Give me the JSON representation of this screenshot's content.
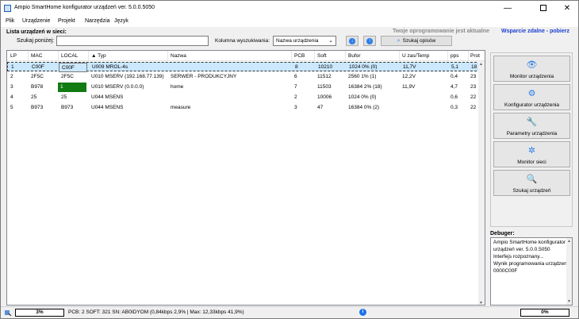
{
  "window": {
    "title": "Ampio SmartHome konfigurator urządzeń ver. 5.0.0.5050",
    "minimize": "—",
    "close": "✕"
  },
  "menu": [
    "Plik",
    "Urządzenie",
    "Projekt",
    "Narzędzia",
    "Język"
  ],
  "header": {
    "list_label": "Lista urządzeń w sieci:",
    "status": "Twoje oprogramowanie jest aktualne",
    "support_link": "Wsparcie zdalne - pobierz",
    "search_label": "Szukaj poniżej:",
    "search_value": "",
    "column_label": "Kolumna wyszukiwania:",
    "column_selected": "Nazwa urządzenia",
    "down_glyph": "↓",
    "up_glyph": "↑",
    "search_desc_label": "Szukaj opisów"
  },
  "table": {
    "columns": [
      "LP",
      "MAC",
      "LOCAL",
      "▲ Typ",
      "Nazwa",
      "PCB",
      "Soft",
      "Bufor",
      "U zas/Temp",
      "pps",
      "Prot"
    ],
    "rows": [
      {
        "lp": "1",
        "mac": "C00F",
        "local": "C00F",
        "typ": "U009 MROL-4s",
        "nazwa": "",
        "pcb": "8",
        "soft": "10210",
        "bufor": "1024 0% (0)",
        "u": "11,7V",
        "pps": "5,1",
        "prot": "18"
      },
      {
        "lp": "2",
        "mac": "2F5C",
        "local": "2F5C",
        "typ": "U010 MSERV (192.168.77.139)",
        "nazwa": "SERWER - PRODUKCYJNY",
        "pcb": "6",
        "soft": "11512",
        "bufor": "2560 1% (1)",
        "u": "12,2V",
        "pps": "0,4",
        "prot": "23"
      },
      {
        "lp": "3",
        "mac": "B978",
        "local": "1",
        "typ": "U010 MSERV (0.0.0.0)",
        "nazwa": "home",
        "pcb": "7",
        "soft": "11503",
        "bufor": "16384 2% (18)",
        "u": "11,9V",
        "pps": "4,7",
        "prot": "23"
      },
      {
        "lp": "4",
        "mac": "25",
        "local": "25",
        "typ": "U044 MSENS",
        "nazwa": "",
        "pcb": "2",
        "soft": "10006",
        "bufor": "1024 0% (0)",
        "u": "",
        "pps": "0,6",
        "prot": "22"
      },
      {
        "lp": "5",
        "mac": "B973",
        "local": "B973",
        "typ": "U044 MSENS",
        "nazwa": "measure",
        "pcb": "3",
        "soft": "47",
        "bufor": "16384 0% (2)",
        "u": "",
        "pps": "0,3",
        "prot": "22"
      }
    ],
    "scroll_up": "▲",
    "scroll_down": "▼"
  },
  "side_buttons": [
    {
      "label": "Monitor urządzenia",
      "icon": "eye-icon",
      "glyph": "👁"
    },
    {
      "label": "Konfigurator urządzenia",
      "icon": "gears-icon",
      "glyph": "⚙"
    },
    {
      "label": "Parametry urządzenia",
      "icon": "wrench-icon",
      "glyph": "🔧"
    },
    {
      "label": "Monitor sieci",
      "icon": "spinner-icon",
      "glyph": "✲"
    },
    {
      "label": "Szukaj urządzeń",
      "icon": "search-icon",
      "glyph": "🔍"
    }
  ],
  "debugger": {
    "label": "Debuger:",
    "lines": [
      "Ampio SmartHome konfigurator",
      "urządzeń ver. 5.0.0.5050",
      "Interfejs rozpoznany...",
      "Wynik programowania urządzenia",
      "0000C00F"
    ]
  },
  "statusbar": {
    "progress_left": 0.03,
    "progress_left_text": "3%",
    "text": "PCB: 2 SOFT: 321 SN: AB0IDYOM (0,84kbps 2,9% | Max: 12,33kbps 41,9%)",
    "info_glyph": "i",
    "progress_right": 0,
    "progress_right_text": "0%"
  },
  "colors": {
    "selected_row": "#cce8ff",
    "local_highlight": "#127a12",
    "link": "#1c3fd1",
    "accent": "#2b7de9"
  }
}
